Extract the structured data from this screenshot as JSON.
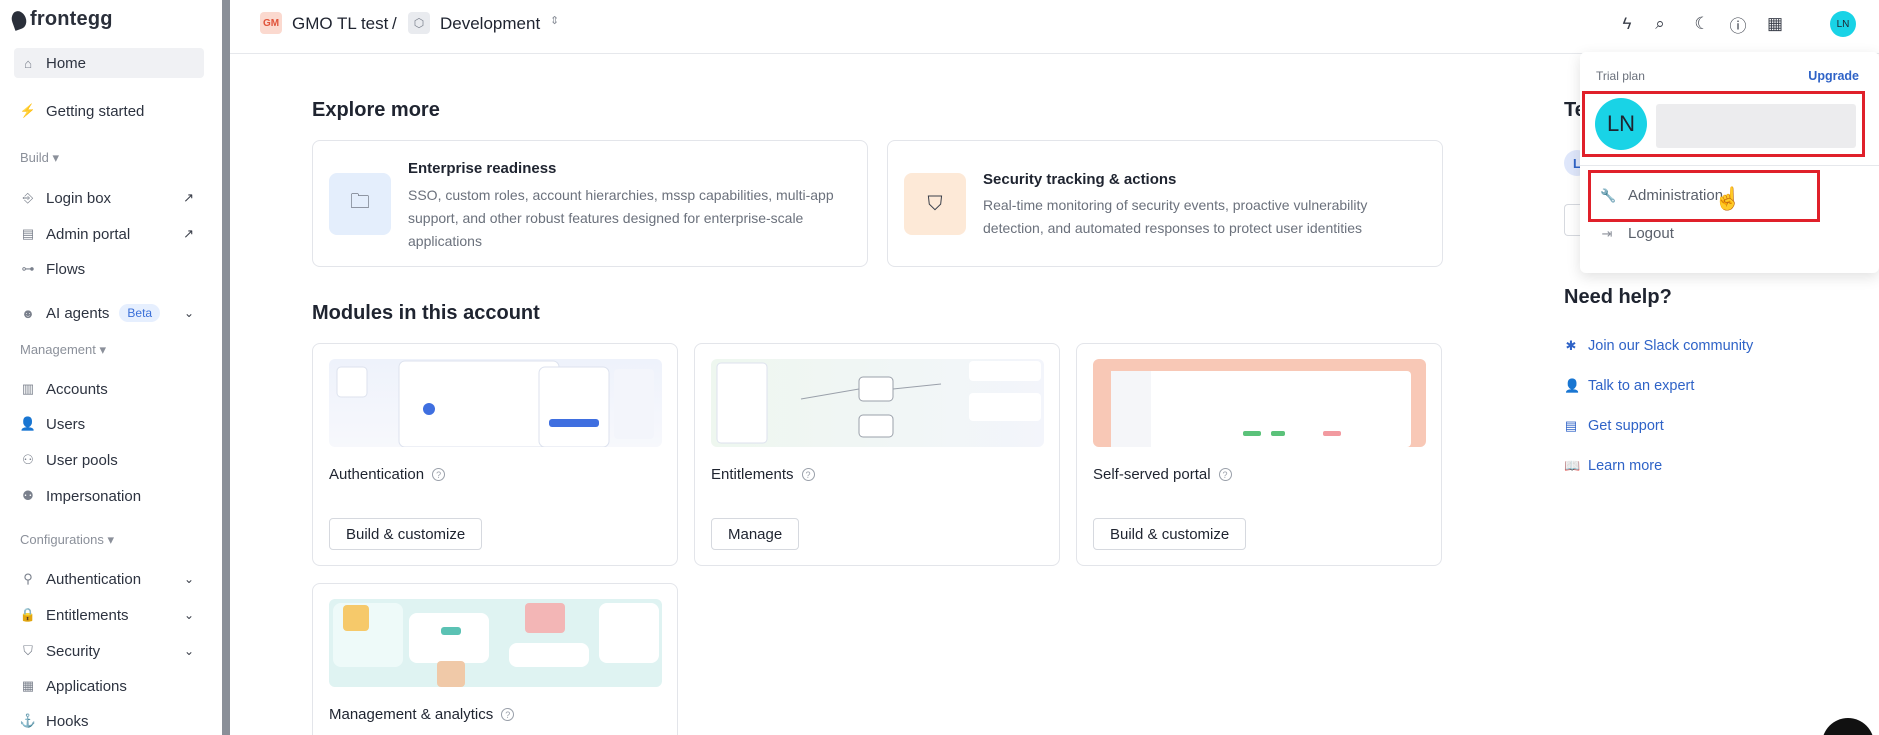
{
  "sidebar": {
    "logo": "frontegg",
    "items": {
      "home": "Home",
      "getting_started": "Getting started",
      "login_box": "Login box",
      "admin_portal": "Admin portal",
      "flows": "Flows",
      "ai_agents": "AI agents",
      "ai_agents_badge": "Beta",
      "accounts": "Accounts",
      "users": "Users",
      "user_pools": "User pools",
      "impersonation": "Impersonation",
      "authentication": "Authentication",
      "entitlements": "Entitlements",
      "security": "Security",
      "applications": "Applications",
      "hooks": "Hooks"
    },
    "sections": {
      "build": "Build",
      "management": "Management",
      "configurations": "Configurations"
    }
  },
  "topbar": {
    "account_initials": "GM",
    "account_name": "GMO TL test",
    "separator": "/",
    "environment": "Development",
    "user_initials": "LN"
  },
  "main": {
    "explore_title": "Explore more",
    "explore_cards": [
      {
        "title": "Enterprise readiness",
        "description": "SSO, custom roles, account hierarchies, mssp capabilities, multi-app support, and other robust features designed for enterprise-scale applications"
      },
      {
        "title": "Security tracking & actions",
        "description": "Real-time monitoring of security events, proactive vulnerability detection, and automated responses to protect user identities"
      }
    ],
    "modules_title": "Modules in this account",
    "modules": [
      {
        "title": "Authentication",
        "button": "Build & customize"
      },
      {
        "title": "Entitlements",
        "button": "Manage"
      },
      {
        "title": "Self-served portal",
        "button": "Build & customize"
      },
      {
        "title": "Management & analytics"
      }
    ]
  },
  "right": {
    "partial_title": "Te",
    "partial_avatar": "L",
    "help_title": "Need help?",
    "help_links": [
      "Join our Slack community",
      "Talk to an expert",
      "Get support",
      "Learn more"
    ]
  },
  "menu": {
    "plan": "Trial plan",
    "upgrade": "Upgrade",
    "avatar_initials": "LN",
    "administration": "Administration",
    "logout": "Logout"
  },
  "colors": {
    "accent_blue": "#2f63c7",
    "avatar_cyan": "#19d3e6",
    "highlight_red": "#e0202a"
  }
}
